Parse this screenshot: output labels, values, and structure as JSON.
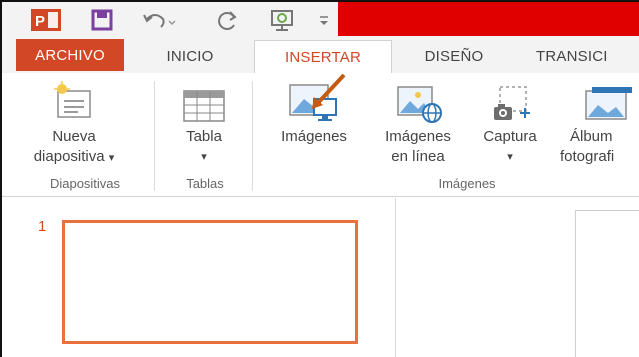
{
  "quick_access": {
    "items": [
      "powerpoint-logo",
      "save",
      "undo",
      "redo",
      "start-from-beginning",
      "customize"
    ],
    "accent_red": "#e00000"
  },
  "tabs": [
    {
      "label": "ARCHIVO"
    },
    {
      "label": "INICIO"
    },
    {
      "label": "INSERTAR"
    },
    {
      "label": "DISEÑO"
    },
    {
      "label": "TRANSICI"
    }
  ],
  "active_tab": "INSERTAR",
  "ribbon": {
    "nueva_line1": "Nueva",
    "nueva_line2": "diapositiva",
    "tabla": "Tabla",
    "imagenes": "Imágenes",
    "imagenes_linea_1": "Imágenes",
    "imagenes_linea_2": "en línea",
    "captura": "Captura",
    "album_1": "Álbum",
    "album_2": "fotografi",
    "dropdown_glyph": "▾",
    "groups": {
      "diapositivas": "Diapositivas",
      "tablas": "Tablas",
      "imagenes": "Imágenes"
    }
  },
  "slides": {
    "number": "1"
  },
  "colors": {
    "accent": "#d24726",
    "thumb_border": "#e8713c",
    "arrow": "#c55a11"
  }
}
